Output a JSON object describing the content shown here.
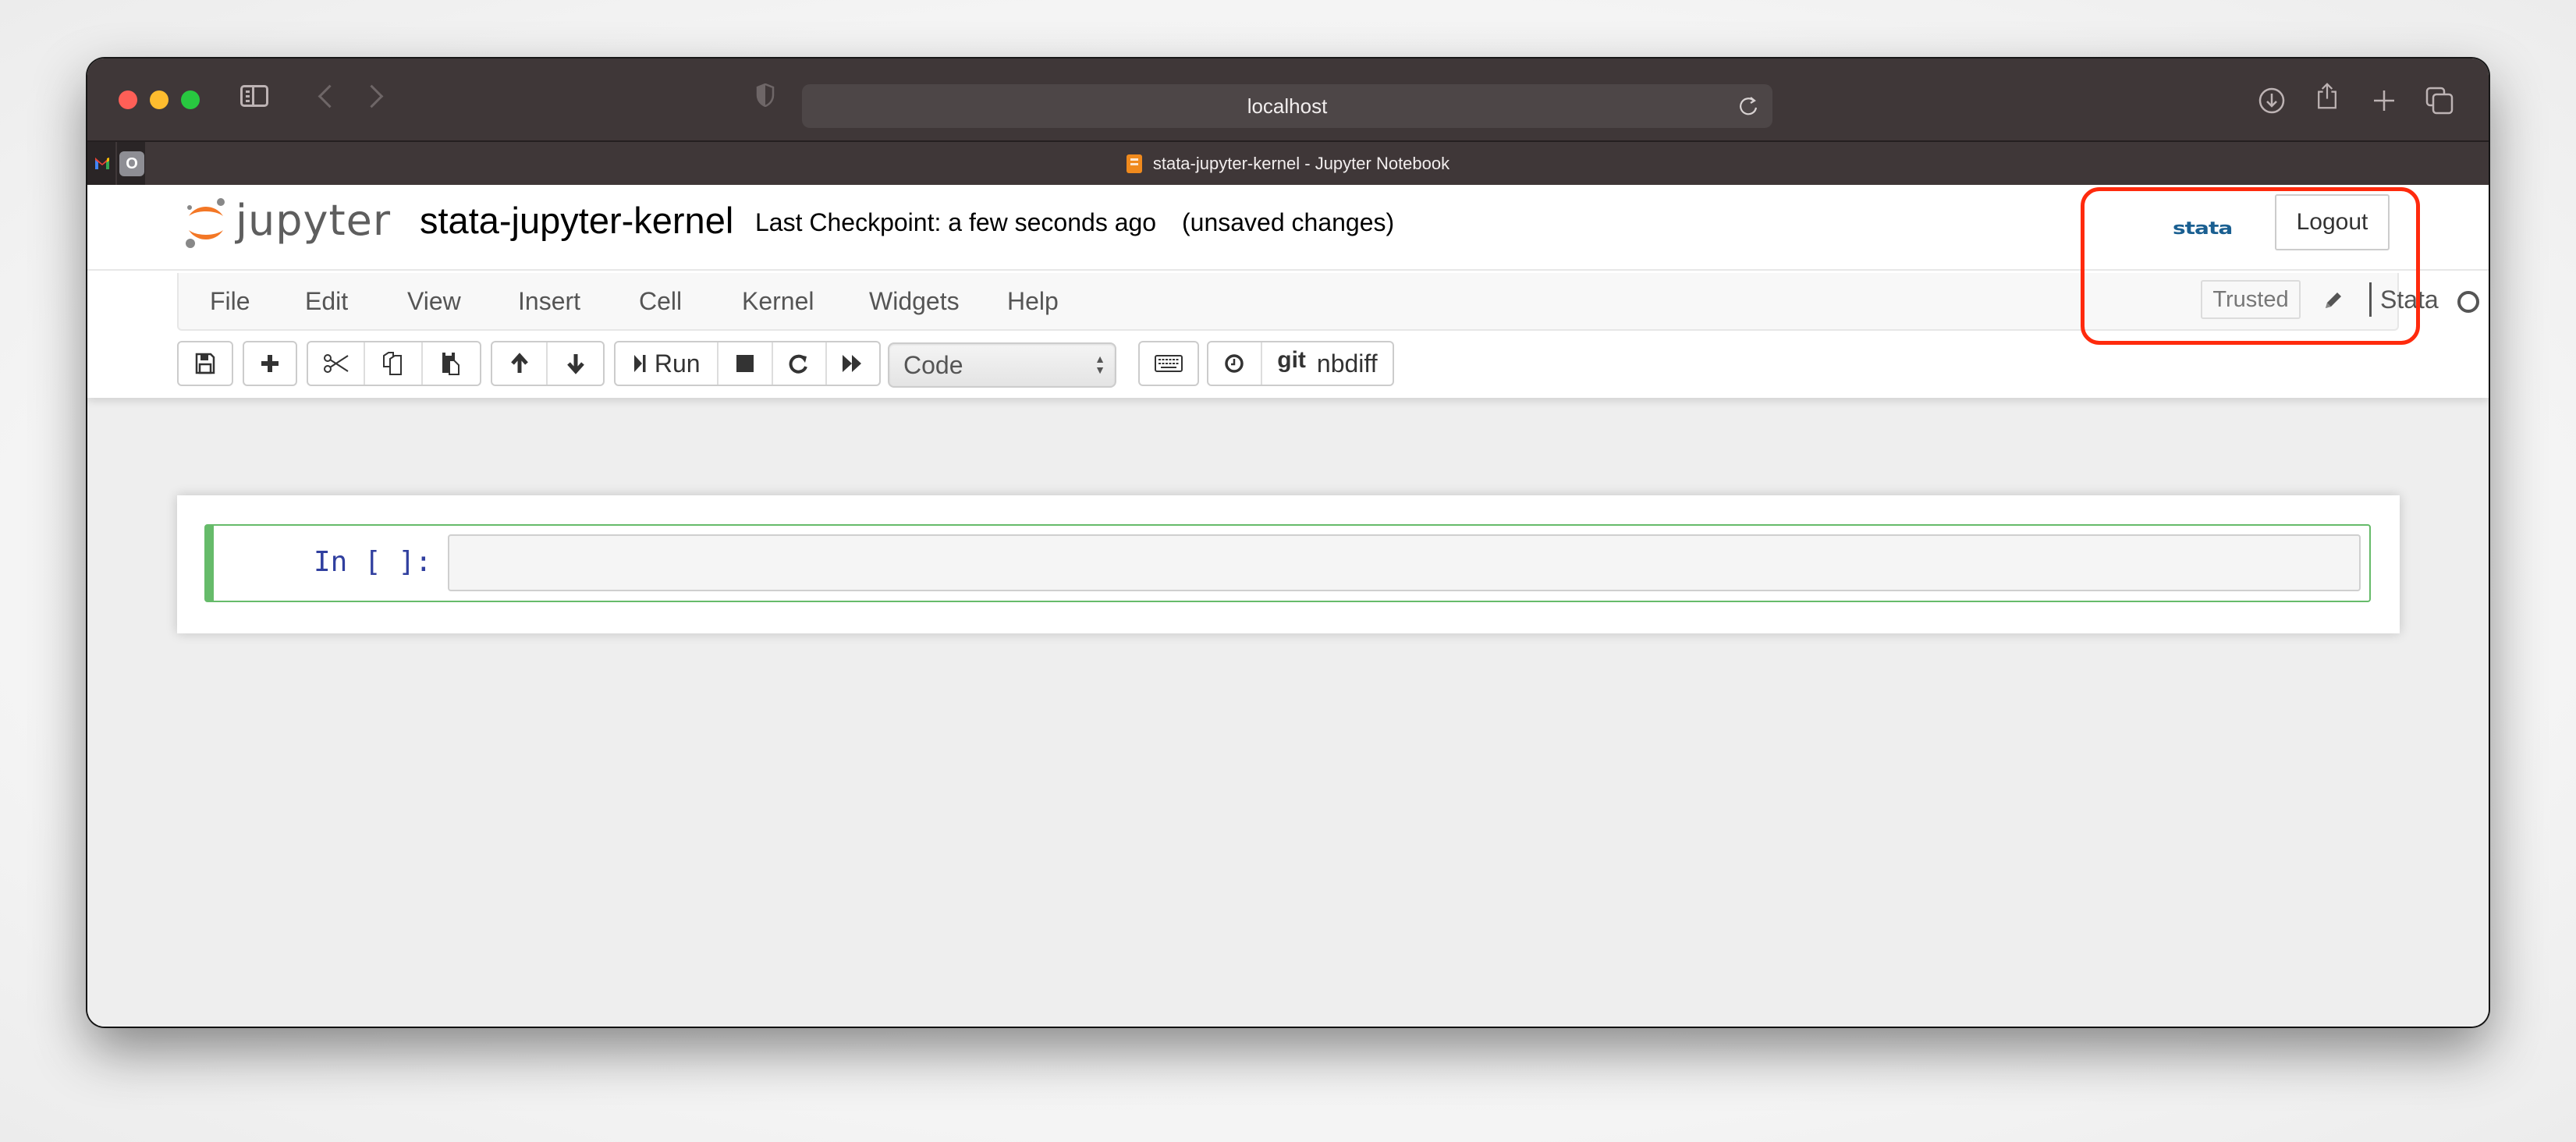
{
  "browser": {
    "address": "localhost",
    "tab_title": "stata-jupyter-kernel - Jupyter Notebook",
    "pinned_tabs": [
      "gmail",
      "O"
    ]
  },
  "header": {
    "logo_text": "jupyter",
    "notebook_name": "stata-jupyter-kernel",
    "checkpoint": "Last Checkpoint: a few seconds ago",
    "autosave_status": "(unsaved changes)",
    "kernel_logo_text": "stata",
    "logout_label": "Logout"
  },
  "menubar": {
    "items": [
      "File",
      "Edit",
      "View",
      "Insert",
      "Cell",
      "Kernel",
      "Widgets",
      "Help"
    ],
    "trusted_label": "Trusted",
    "kernel_name": "Stata"
  },
  "toolbar": {
    "run_label": "Run",
    "cell_type": "Code",
    "git_label": "git",
    "nbdiff_label": "nbdiff"
  },
  "cells": [
    {
      "prompt": "In [ ]:",
      "source": ""
    }
  ],
  "colors": {
    "accent_green": "#66bb6a",
    "prompt_blue": "#303f9f",
    "annotation_red": "#ff2a0d",
    "stata_blue": "#1a5f91",
    "jupyter_orange": "#f37726"
  }
}
